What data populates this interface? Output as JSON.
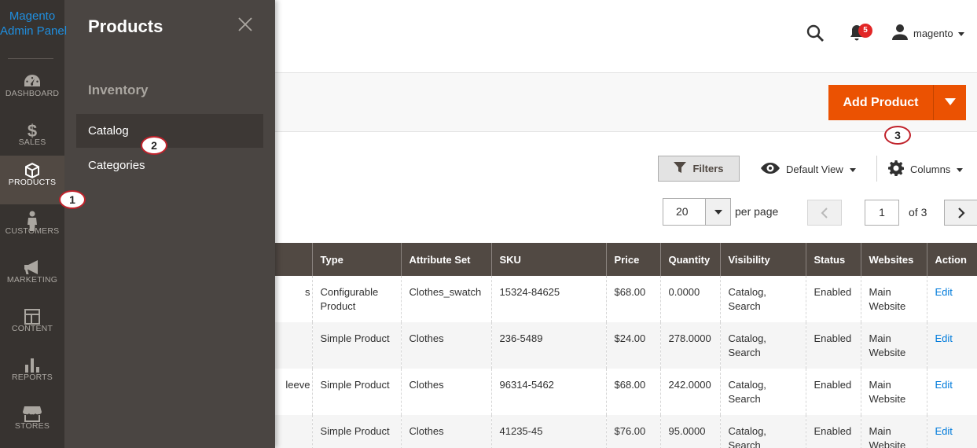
{
  "logo": {
    "line1": "Magento",
    "line2": "Admin Panel"
  },
  "nav": [
    {
      "key": "dashboard",
      "label": "DASHBOARD",
      "icon": "dashboard-icon"
    },
    {
      "key": "sales",
      "label": "SALES",
      "icon": "dollar-icon"
    },
    {
      "key": "products",
      "label": "PRODUCTS",
      "icon": "box-icon",
      "active": true
    },
    {
      "key": "customers",
      "label": "CUSTOMERS",
      "icon": "person-icon"
    },
    {
      "key": "marketing",
      "label": "MARKETING",
      "icon": "megaphone-icon"
    },
    {
      "key": "content",
      "label": "CONTENT",
      "icon": "layout-icon"
    },
    {
      "key": "reports",
      "label": "REPORTS",
      "icon": "bar-chart-icon"
    },
    {
      "key": "stores",
      "label": "STORES",
      "icon": "store-icon"
    }
  ],
  "flyout": {
    "title": "Products",
    "section": "Inventory",
    "items": [
      "Catalog",
      "Categories"
    ]
  },
  "callouts": [
    "1",
    "2",
    "3"
  ],
  "header": {
    "notifications_count": "5",
    "username": "magento"
  },
  "actions": {
    "add_product": "Add Product"
  },
  "grid_controls": {
    "filters": "Filters",
    "view": "Default View",
    "columns": "Columns",
    "per_page_value": "20",
    "per_page_label": "per page",
    "page_current": "1",
    "page_total_label": "of 3"
  },
  "table": {
    "columns": [
      "",
      "Type",
      "Attribute Set",
      "SKU",
      "Price",
      "Quantity",
      "Visibility",
      "Status",
      "Websites",
      "Action"
    ],
    "rows": [
      {
        "name": "s",
        "type": "Configurable Product",
        "attribute_set": "Clothes_swatch",
        "sku": "15324-84625",
        "price": "$68.00",
        "quantity": "0.0000",
        "visibility": "Catalog, Search",
        "status": "Enabled",
        "websites": "Main Website",
        "action": "Edit"
      },
      {
        "name": "",
        "type": "Simple Product",
        "attribute_set": "Clothes",
        "sku": "236-5489",
        "price": "$24.00",
        "quantity": "278.0000",
        "visibility": "Catalog, Search",
        "status": "Enabled",
        "websites": "Main Website",
        "action": "Edit"
      },
      {
        "name": "leeve",
        "type": "Simple Product",
        "attribute_set": "Clothes",
        "sku": "96314-5462",
        "price": "$68.00",
        "quantity": "242.0000",
        "visibility": "Catalog, Search",
        "status": "Enabled",
        "websites": "Main Website",
        "action": "Edit"
      },
      {
        "name": "",
        "type": "Simple Product",
        "attribute_set": "Clothes",
        "sku": "41235-45",
        "price": "$76.00",
        "quantity": "95.0000",
        "visibility": "Catalog, Search",
        "status": "Enabled",
        "websites": "Main Website",
        "action": "Edit"
      }
    ]
  }
}
